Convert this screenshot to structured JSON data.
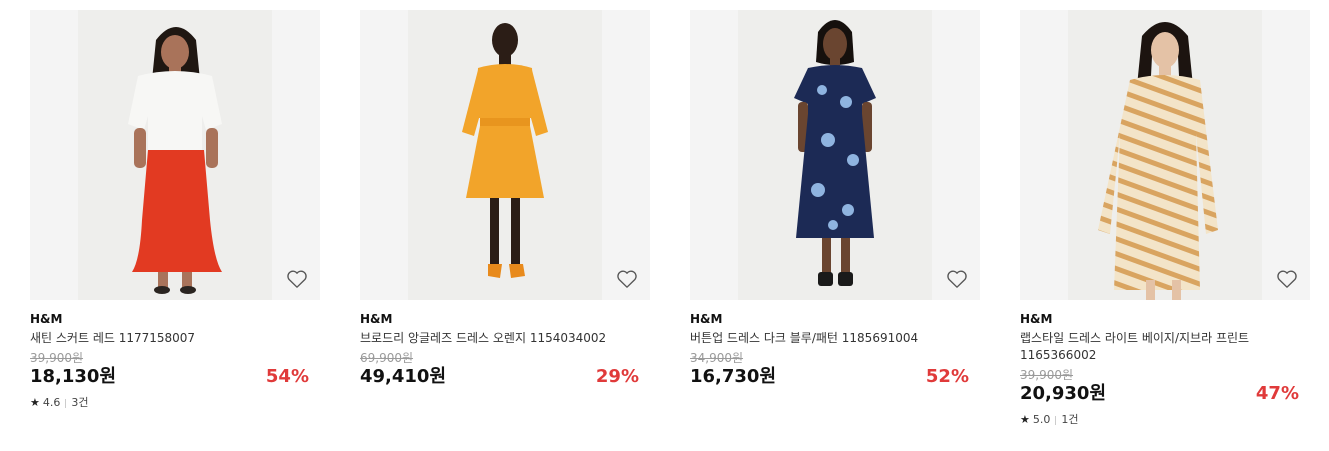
{
  "products": [
    {
      "brand": "H&M",
      "name": "새틴 스커트 레드 1177158007",
      "original_price": "39,900원",
      "price": "18,130원",
      "discount": "54%",
      "rating": "4.6",
      "review_count": "3건",
      "image_colors": {
        "top": "#f7f7f5",
        "bottom": "#e23a22",
        "skin": "#a9735a",
        "hair": "#1f1712",
        "shoes": "#2a2420"
      }
    },
    {
      "brand": "H&M",
      "name": "브로드리 앙글레즈 드레스 오렌지 1154034002",
      "original_price": "69,900원",
      "price": "49,410원",
      "discount": "29%",
      "image_colors": {
        "dress": "#f2a42a",
        "skin": "#2b1d16",
        "hair": "#1a1210",
        "shoes": "#e88a1c"
      }
    },
    {
      "brand": "H&M",
      "name": "버튼업 드레스 다크 블루/패턴 1185691004",
      "original_price": "34,900원",
      "price": "16,730원",
      "discount": "52%",
      "image_colors": {
        "dress": "#1c2a55",
        "pattern": "#8fb4e0",
        "skin": "#6a4530",
        "hair": "#15100d",
        "shoes": "#1a1a1a"
      }
    },
    {
      "brand": "H&M",
      "name": "랩스타일 드레스 라이트 베이지/지브라 프린트 1165366002",
      "original_price": "39,900원",
      "price": "20,930원",
      "discount": "47%",
      "rating": "5.0",
      "review_count": "1건",
      "image_colors": {
        "dress": "#f3e4c8",
        "stripe": "#d9a460",
        "skin": "#e4c2a6",
        "hair": "#1c1410"
      }
    }
  ],
  "wishlist_icon": "heart-outline-icon",
  "rating_icon": "star-icon",
  "accent_discount_color": "#e03a3a"
}
